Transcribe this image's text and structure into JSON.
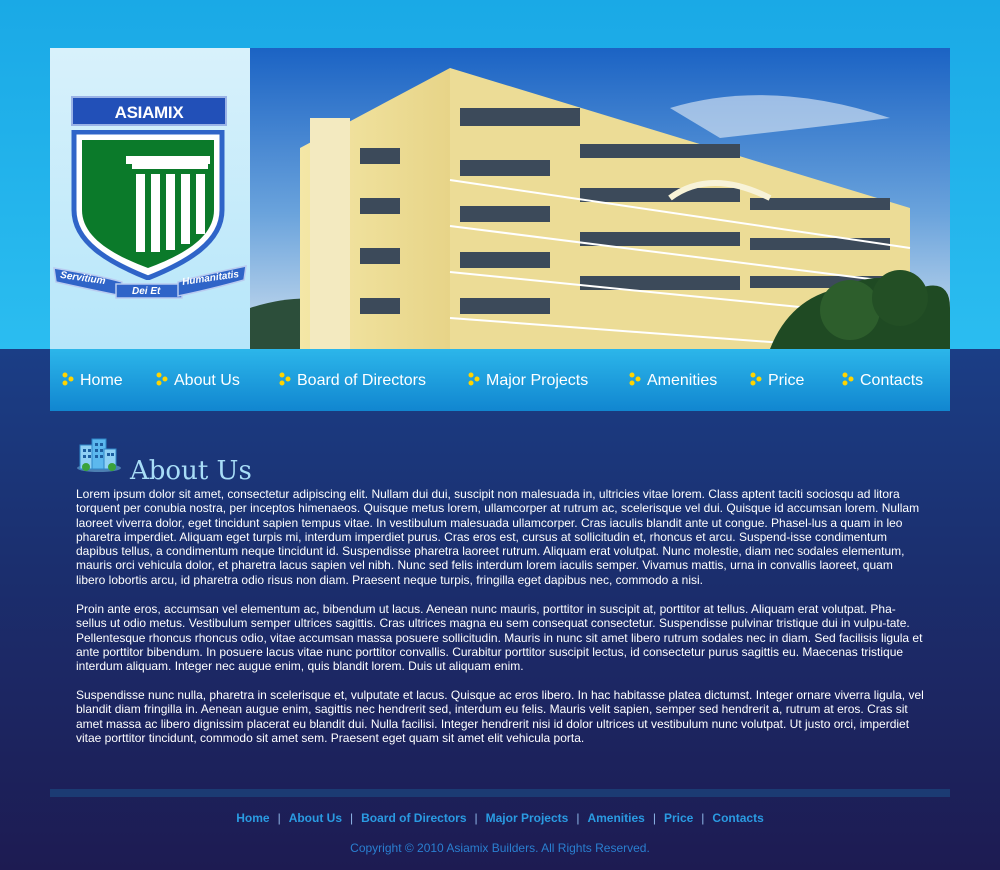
{
  "logo": {
    "name": "ASIAMIX BUILDERS",
    "motto_left": "Servitium",
    "motto_center": "Dei Et",
    "motto_right": "Humanitatis"
  },
  "nav": {
    "items": [
      {
        "label": "Home"
      },
      {
        "label": "About Us"
      },
      {
        "label": "Board of Directors"
      },
      {
        "label": "Major Projects"
      },
      {
        "label": "Amenities"
      },
      {
        "label": "Price"
      },
      {
        "label": "Contacts"
      }
    ]
  },
  "content": {
    "title": "About Us",
    "paragraphs": [
      "Lorem ipsum dolor sit amet, consectetur adipiscing elit. Nullam dui dui, suscipit non malesuada in, ultricies vitae lorem. Class aptent taciti sociosqu ad litora torquent per conubia nostra, per inceptos himenaeos. Quisque metus lorem, ullamcorper at rutrum ac, scelerisque vel dui. Quisque id accumsan lorem. Nullam laoreet viverra dolor, eget tincidunt sapien tempus vitae. In vestibulum malesuada ullamcorper. Cras iaculis blandit ante ut congue. Phasel-lus a quam in leo pharetra imperdiet. Aliquam eget turpis mi, interdum imperdiet purus. Cras eros est, cursus at sollicitudin et, rhoncus et arcu. Suspend-isse condimentum dapibus tellus, a condimentum neque tincidunt id. Suspendisse pharetra laoreet rutrum. Aliquam erat volutpat. Nunc molestie, diam nec sodales elementum, mauris orci vehicula dolor, et pharetra lacus sapien vel nibh. Nunc sed felis interdum lorem iaculis semper. Vivamus mattis, urna in convallis laoreet, quam libero lobortis arcu, id pharetra odio risus non diam. Praesent neque turpis, fringilla eget dapibus nec, commodo a nisi.",
      "Proin ante eros, accumsan vel elementum ac, bibendum ut lacus. Aenean nunc mauris, porttitor in suscipit at, porttitor at tellus. Aliquam erat volutpat. Pha-sellus ut odio metus. Vestibulum semper ultrices sagittis. Cras ultrices magna eu sem consequat consectetur. Suspendisse pulvinar tristique dui in vulpu-tate. Pellentesque rhoncus rhoncus odio, vitae accumsan massa posuere sollicitudin. Mauris in nunc sit amet libero rutrum sodales nec in diam. Sed facilisis ligula et ante porttitor bibendum. In posuere lacus vitae nunc porttitor convallis. Curabitur porttitor suscipit lectus, id consectetur purus sagittis eu. Maecenas tristique interdum aliquam. Integer nec augue enim, quis blandit lorem. Duis ut aliquam enim.",
      "Suspendisse nunc nulla, pharetra in scelerisque et, vulputate et lacus. Quisque ac eros libero. In hac habitasse platea dictumst. Integer ornare viverra ligula, vel blandit diam fringilla in. Aenean augue enim, sagittis nec hendrerit sed, interdum eu felis. Mauris velit sapien, semper sed hendrerit a, rutrum at eros. Cras sit amet massa ac libero dignissim placerat eu blandit dui. Nulla facilisi. Integer hendrerit nisi id dolor ultrices ut vestibulum nunc volutpat. Ut justo orci, imperdiet vitae porttitor tincidunt, commodo sit amet sem. Praesent eget quam sit amet elit vehicula porta."
    ]
  },
  "footer": {
    "links": [
      {
        "label": "Home"
      },
      {
        "label": "About Us"
      },
      {
        "label": "Board of Directors"
      },
      {
        "label": "Major Projects"
      },
      {
        "label": "Amenities"
      },
      {
        "label": "Price"
      },
      {
        "label": "Contacts"
      }
    ],
    "separator": "|",
    "copyright": "Copyright © 2010 Asiamix Builders.  All Rights Reserved."
  },
  "colors": {
    "top_background": "#1aa9e6",
    "body_background": "#1b2f6f",
    "nav_background": "#1d9ddf",
    "logo_blue": "#2250b8",
    "logo_green": "#0b7a2a",
    "link_blue": "#2a9be2",
    "title_color": "#a8ddf7"
  }
}
